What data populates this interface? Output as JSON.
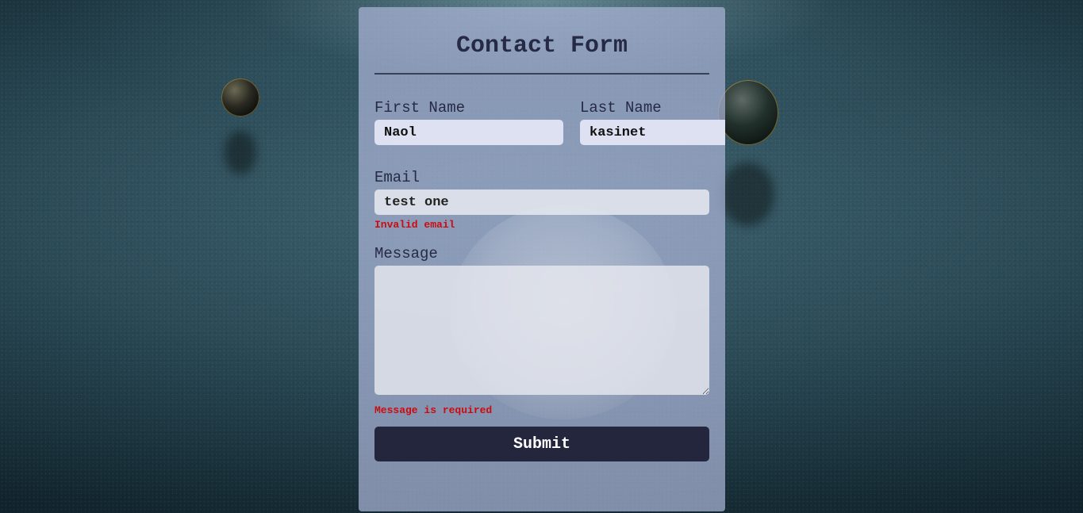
{
  "form": {
    "title": "Contact Form",
    "first_name": {
      "label": "First Name",
      "value": "Naol"
    },
    "last_name": {
      "label": "Last Name",
      "value": "kasinet"
    },
    "email": {
      "label": "Email",
      "value": "test one",
      "error": "Invalid email"
    },
    "message": {
      "label": "Message",
      "value": "",
      "error": "Message is required"
    },
    "submit_label": "Submit"
  },
  "colors": {
    "card_background": "#aab4d7",
    "title_text": "#262a44",
    "error_text": "#cc0b10",
    "button_background": "#23263c",
    "button_text": "#ffffff"
  }
}
